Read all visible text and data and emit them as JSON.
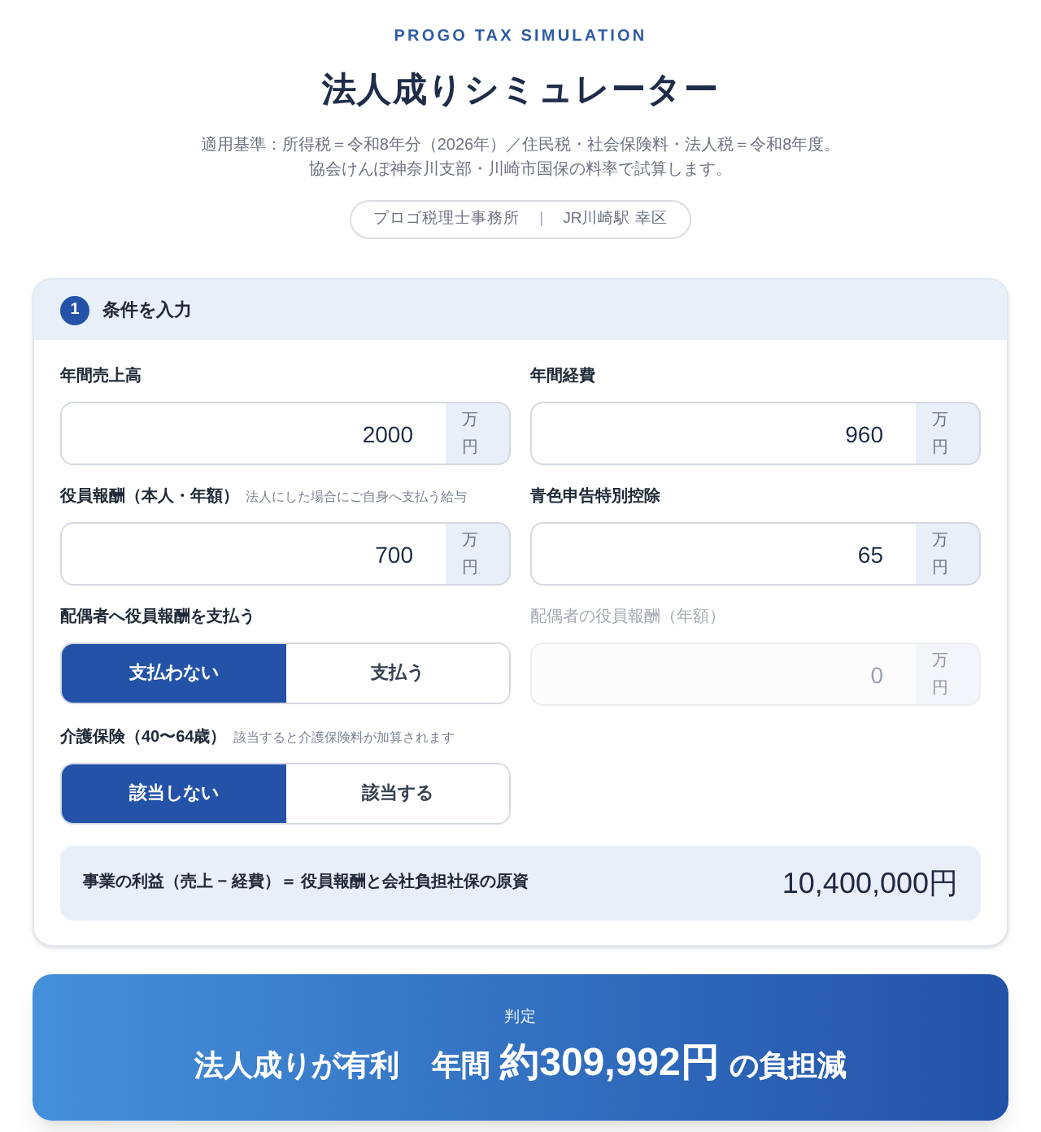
{
  "header": {
    "eyebrow": "PROGO TAX SIMULATION",
    "title": "法人成りシミュレーター",
    "notes": [
      "適用基準：所得税＝令和8年分（2026年）／住民税・社会保険料・法人税＝令和8年度。",
      "協会けんぽ神奈川支部・川崎市国保の料率で試算します。"
    ],
    "office_badge": {
      "name": "プロゴ税理士事務所",
      "separator": "|",
      "location": "JR川崎駅 幸区"
    }
  },
  "section": {
    "number": "1",
    "title": "条件を入力",
    "fields": [
      {
        "kind": "amount",
        "label": "年間売上高",
        "value": "2000",
        "unit": "万円",
        "disabled": false
      },
      {
        "kind": "amount",
        "label": "年間経費",
        "value": "960",
        "unit": "万円",
        "disabled": false
      },
      {
        "kind": "amount",
        "label": "役員報酬（本人・年額）",
        "hint": "法人にした場合にご自身へ支払う給与",
        "value": "700",
        "unit": "万円",
        "disabled": false
      },
      {
        "kind": "amount",
        "label": "青色申告特別控除",
        "value": "65",
        "unit": "万円",
        "disabled": false
      },
      {
        "kind": "toggle",
        "label": "配偶者へ役員報酬を支払う",
        "options": [
          {
            "label": "支払わない",
            "selected": true
          },
          {
            "label": "支払う",
            "selected": false
          }
        ]
      },
      {
        "kind": "amount",
        "label": "配偶者の役員報酬（年額）",
        "value": "0",
        "unit": "万円",
        "disabled": true
      },
      {
        "kind": "toggle",
        "label": "介護保険（40〜64歳）",
        "hint": "該当すると介護保険料が加算されます",
        "options": [
          {
            "label": "該当しない",
            "selected": true
          },
          {
            "label": "該当する",
            "selected": false
          }
        ]
      }
    ],
    "profit": {
      "label": "事業の利益（売上 − 経費）＝ 役員報酬と会社負担社保の原資",
      "value": "10,400,000円"
    }
  },
  "result": {
    "label": "判定",
    "headline": {
      "verdict": "法人成りが有利",
      "period": "年間",
      "amount": "約309,992円",
      "suffix": "の負担減"
    }
  }
}
